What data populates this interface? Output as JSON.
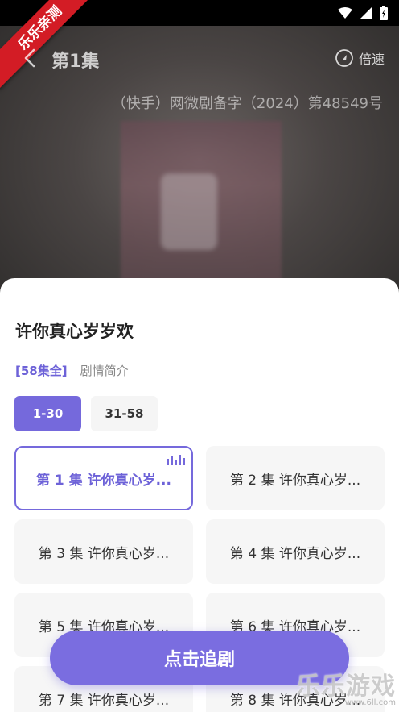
{
  "status_bar": {
    "icons": [
      "wifi-icon",
      "signal-icon",
      "battery-icon"
    ]
  },
  "ribbon": {
    "text": "乐乐亲测"
  },
  "player": {
    "episode_title": "第1集",
    "speed_label": "倍速",
    "license_text": "（快手）网微剧备字（2024）第48549号"
  },
  "sheet": {
    "title": "许你真心岁岁欢",
    "episode_count": "[58集全]",
    "intro_label": "剧情简介",
    "ranges": [
      {
        "label": "1-30",
        "active": true
      },
      {
        "label": "31-58",
        "active": false
      }
    ],
    "episodes": [
      {
        "label": "第 1 集 许你真心岁...",
        "active": true
      },
      {
        "label": "第 2 集 许你真心岁...",
        "active": false
      },
      {
        "label": "第 3 集 许你真心岁...",
        "active": false
      },
      {
        "label": "第 4 集 许你真心岁...",
        "active": false
      },
      {
        "label": "第 5 集 许你真心岁...",
        "active": false
      },
      {
        "label": "第 6 集 许你真心岁...",
        "active": false
      },
      {
        "label": "第 7 集 许你真心岁...",
        "active": false
      },
      {
        "label": "第 8 集 许你真心岁...",
        "active": false
      }
    ],
    "follow_button": "点击追剧"
  },
  "watermark": {
    "text": "乐乐游戏",
    "url": "www.6ll.com"
  },
  "colors": {
    "accent": "#7569dc",
    "ribbon": "#d31c25"
  }
}
